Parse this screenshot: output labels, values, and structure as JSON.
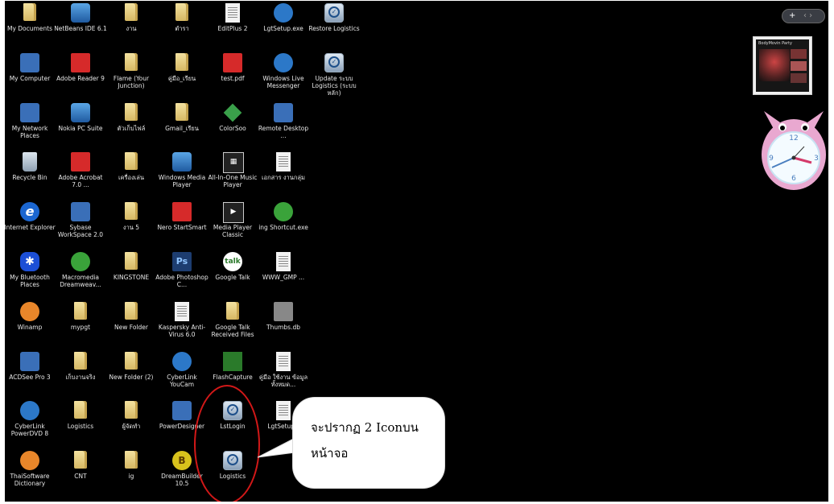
{
  "desktop": {
    "icons": [
      {
        "col": 0,
        "row": 0,
        "label": "My Documents",
        "glyph": "g-folder",
        "icon": "my-documents-icon",
        "txt": ""
      },
      {
        "col": 1,
        "row": 0,
        "label": "NetBeans IDE 6.1",
        "glyph": "g-blue",
        "icon": "netbeans-icon",
        "txt": ""
      },
      {
        "col": 2,
        "row": 0,
        "label": "งาน",
        "glyph": "g-folder",
        "icon": "folder-icon",
        "txt": ""
      },
      {
        "col": 3,
        "row": 0,
        "label": "ตำรา",
        "glyph": "g-folder",
        "icon": "folder-icon",
        "txt": ""
      },
      {
        "col": 4,
        "row": 0,
        "label": "EditPlus 2",
        "glyph": "g-doc",
        "icon": "editplus-icon",
        "txt": ""
      },
      {
        "col": 5,
        "row": 0,
        "label": "LgtSetup.exe",
        "glyph": "g-circle",
        "icon": "setup-exe-icon",
        "txt": ""
      },
      {
        "col": 6,
        "row": 0,
        "label": "Restore Logistics",
        "glyph": "g-tscheck",
        "icon": "ts-check-icon",
        "txt": "✓"
      },
      {
        "col": 0,
        "row": 1,
        "label": "My Computer",
        "glyph": "g-app",
        "icon": "my-computer-icon",
        "txt": ""
      },
      {
        "col": 1,
        "row": 1,
        "label": "Adobe Reader 9",
        "glyph": "g-red",
        "icon": "adobe-reader-icon",
        "txt": ""
      },
      {
        "col": 2,
        "row": 1,
        "label": "Flame (Your Junction)",
        "glyph": "g-folder",
        "icon": "folder-icon",
        "txt": ""
      },
      {
        "col": 3,
        "row": 1,
        "label": "คู่มือ_เรียน",
        "glyph": "g-folder",
        "icon": "folder-icon",
        "txt": ""
      },
      {
        "col": 4,
        "row": 1,
        "label": "test.pdf",
        "glyph": "g-red",
        "icon": "pdf-file-icon",
        "txt": ""
      },
      {
        "col": 5,
        "row": 1,
        "label": "Windows Live Messenger",
        "glyph": "g-circle",
        "icon": "messenger-icon",
        "txt": ""
      },
      {
        "col": 6,
        "row": 1,
        "label": "Update ระบบ Logistics (ระบบหลัก)",
        "glyph": "g-tscheck",
        "icon": "ts-check-icon",
        "txt": "✓"
      },
      {
        "col": 0,
        "row": 2,
        "label": "My Network Places",
        "glyph": "g-app",
        "icon": "network-places-icon",
        "txt": ""
      },
      {
        "col": 1,
        "row": 2,
        "label": "Nokia PC Suite",
        "glyph": "g-blue",
        "icon": "nokia-pc-suite-icon",
        "txt": ""
      },
      {
        "col": 2,
        "row": 2,
        "label": "ตัวเก็บไฟล์",
        "glyph": "g-folder",
        "icon": "folder-icon",
        "txt": ""
      },
      {
        "col": 3,
        "row": 2,
        "label": "Gmail_เรียน",
        "glyph": "g-folder",
        "icon": "folder-icon",
        "txt": ""
      },
      {
        "col": 4,
        "row": 2,
        "label": "ColorSoo",
        "glyph": "g-diamond",
        "icon": "colorsoo-icon",
        "txt": ""
      },
      {
        "col": 5,
        "row": 2,
        "label": "Remote Desktop ...",
        "glyph": "g-app",
        "icon": "remote-desktop-icon",
        "txt": ""
      },
      {
        "col": 0,
        "row": 3,
        "label": "Recycle Bin",
        "glyph": "g-bin",
        "icon": "recycle-bin-icon",
        "txt": ""
      },
      {
        "col": 1,
        "row": 3,
        "label": "Adobe Acrobat 7.0 ...",
        "glyph": "g-red",
        "icon": "adobe-acrobat-icon",
        "txt": ""
      },
      {
        "col": 2,
        "row": 3,
        "label": "เครื่องเล่น",
        "glyph": "g-folder",
        "icon": "folder-icon",
        "txt": ""
      },
      {
        "col": 3,
        "row": 3,
        "label": "Windows Media Player",
        "glyph": "g-blue",
        "icon": "media-player-icon",
        "txt": ""
      },
      {
        "col": 4,
        "row": 3,
        "label": "All-In-One Music Player",
        "glyph": "g-media",
        "icon": "all-in-one-icon",
        "txt": "▦"
      },
      {
        "col": 5,
        "row": 3,
        "label": "เอกสาร งานกลุ่ม",
        "glyph": "g-doc",
        "icon": "word-doc-icon",
        "txt": ""
      },
      {
        "col": 0,
        "row": 4,
        "label": "Internet Explorer",
        "glyph": "g-ie",
        "icon": "internet-explorer-icon",
        "txt": "e"
      },
      {
        "col": 1,
        "row": 4,
        "label": "Sybase WorkSpace 2.0",
        "glyph": "g-app",
        "icon": "sybase-icon",
        "txt": ""
      },
      {
        "col": 2,
        "row": 4,
        "label": "งาน 5",
        "glyph": "g-folder",
        "icon": "folder-icon",
        "txt": ""
      },
      {
        "col": 3,
        "row": 4,
        "label": "Nero StartSmart",
        "glyph": "g-red",
        "icon": "nero-icon",
        "txt": ""
      },
      {
        "col": 4,
        "row": 4,
        "label": "Media Player Classic",
        "glyph": "g-media",
        "icon": "media-player-classic-icon",
        "txt": "▶"
      },
      {
        "col": 5,
        "row": 4,
        "label": "ing Shortcut.exe",
        "glyph": "g-green",
        "icon": "shortcut-exe-icon",
        "txt": ""
      },
      {
        "col": 0,
        "row": 5,
        "label": "My Bluetooth Places",
        "glyph": "g-bt",
        "icon": "bluetooth-icon",
        "txt": "✱"
      },
      {
        "col": 1,
        "row": 5,
        "label": "Macromedia Dreamweav...",
        "glyph": "g-green",
        "icon": "dreamweaver-icon",
        "txt": ""
      },
      {
        "col": 2,
        "row": 5,
        "label": "KINGSTONE",
        "glyph": "g-folder",
        "icon": "folder-icon",
        "txt": ""
      },
      {
        "col": 3,
        "row": 5,
        "label": "Adobe Photoshop C...",
        "glyph": "g-ps",
        "icon": "photoshop-icon",
        "txt": "Ps"
      },
      {
        "col": 4,
        "row": 5,
        "label": "Google Talk",
        "glyph": "g-talk",
        "icon": "google-talk-icon",
        "txt": "talk"
      },
      {
        "col": 5,
        "row": 5,
        "label": "WWW_GMP ...",
        "glyph": "g-doc",
        "icon": "text-file-icon",
        "txt": ""
      },
      {
        "col": 0,
        "row": 6,
        "label": "Winamp",
        "glyph": "g-orange",
        "icon": "winamp-icon",
        "txt": ""
      },
      {
        "col": 1,
        "row": 6,
        "label": "mypgt",
        "glyph": "g-folder",
        "icon": "folder-icon",
        "txt": ""
      },
      {
        "col": 2,
        "row": 6,
        "label": "New Folder",
        "glyph": "g-folder",
        "icon": "folder-icon",
        "txt": ""
      },
      {
        "col": 3,
        "row": 6,
        "label": "Kaspersky Anti-Virus 6.0",
        "glyph": "g-doc",
        "icon": "kaspersky-icon",
        "txt": ""
      },
      {
        "col": 4,
        "row": 6,
        "label": "Google Talk Received Files",
        "glyph": "g-folder",
        "icon": "folder-icon",
        "txt": ""
      },
      {
        "col": 5,
        "row": 6,
        "label": "Thumbs.db",
        "glyph": "g-grey",
        "icon": "thumbs-db-icon",
        "txt": ""
      },
      {
        "col": 0,
        "row": 7,
        "label": "ACDSee Pro 3",
        "glyph": "g-app",
        "icon": "acdsee-icon",
        "txt": ""
      },
      {
        "col": 1,
        "row": 7,
        "label": "เก็บงานจริง",
        "glyph": "g-folder",
        "icon": "folder-icon",
        "txt": ""
      },
      {
        "col": 2,
        "row": 7,
        "label": "New Folder (2)",
        "glyph": "g-folder",
        "icon": "folder-icon",
        "txt": ""
      },
      {
        "col": 3,
        "row": 7,
        "label": "CyberLink YouCam",
        "glyph": "g-circle",
        "icon": "youcam-icon",
        "txt": ""
      },
      {
        "col": 4,
        "row": 7,
        "label": "FlashCapture",
        "glyph": "g-tank",
        "icon": "flash-capture-icon",
        "txt": ""
      },
      {
        "col": 5,
        "row": 7,
        "label": "คู่มือ ใช้งาน ข้อมูลทั้งหมด...",
        "glyph": "g-doc",
        "icon": "text-file-icon",
        "txt": ""
      },
      {
        "col": 0,
        "row": 8,
        "label": "CyberLink PowerDVD 8",
        "glyph": "g-circle",
        "icon": "powerdvd-icon",
        "txt": ""
      },
      {
        "col": 1,
        "row": 8,
        "label": "Logistics",
        "glyph": "g-folder",
        "icon": "folder-icon",
        "txt": ""
      },
      {
        "col": 2,
        "row": 8,
        "label": "ผู้จัดทำ",
        "glyph": "g-folder",
        "icon": "folder-icon",
        "txt": ""
      },
      {
        "col": 3,
        "row": 8,
        "label": "PowerDesigner",
        "glyph": "g-app",
        "icon": "powerdesigner-icon",
        "txt": ""
      },
      {
        "col": 4,
        "row": 8,
        "label": "LstLogin",
        "glyph": "g-tscheck",
        "icon": "ts-check-icon",
        "txt": "✓"
      },
      {
        "col": 5,
        "row": 8,
        "label": "LgtSetupN",
        "glyph": "g-doc",
        "icon": "setup-icon",
        "txt": ""
      },
      {
        "col": 0,
        "row": 9,
        "label": "ThaiSoftware Dictionary",
        "glyph": "g-orange",
        "icon": "dictionary-icon",
        "txt": ""
      },
      {
        "col": 1,
        "row": 9,
        "label": "CNT",
        "glyph": "g-folder",
        "icon": "folder-icon",
        "txt": ""
      },
      {
        "col": 2,
        "row": 9,
        "label": "ig",
        "glyph": "g-folder",
        "icon": "folder-icon",
        "txt": ""
      },
      {
        "col": 3,
        "row": 9,
        "label": "DreamBuilder 10.5",
        "glyph": "g-yellow",
        "icon": "dreambuilder-icon",
        "txt": "B"
      },
      {
        "col": 4,
        "row": 9,
        "label": "Logistics",
        "glyph": "g-tscheck",
        "icon": "ts-check-icon",
        "txt": "✓"
      }
    ]
  },
  "widgets": {
    "top_button_plus": "+",
    "top_button_nav": "‹ ›",
    "slideshow_caption": "BodyMovin Party"
  },
  "callout": {
    "line1": "จะปรากฏ 2 Iconบน",
    "line2": "หน้าจอ"
  },
  "colors": {
    "desktop_bg": "#000000",
    "highlight_ring": "#d21818"
  }
}
